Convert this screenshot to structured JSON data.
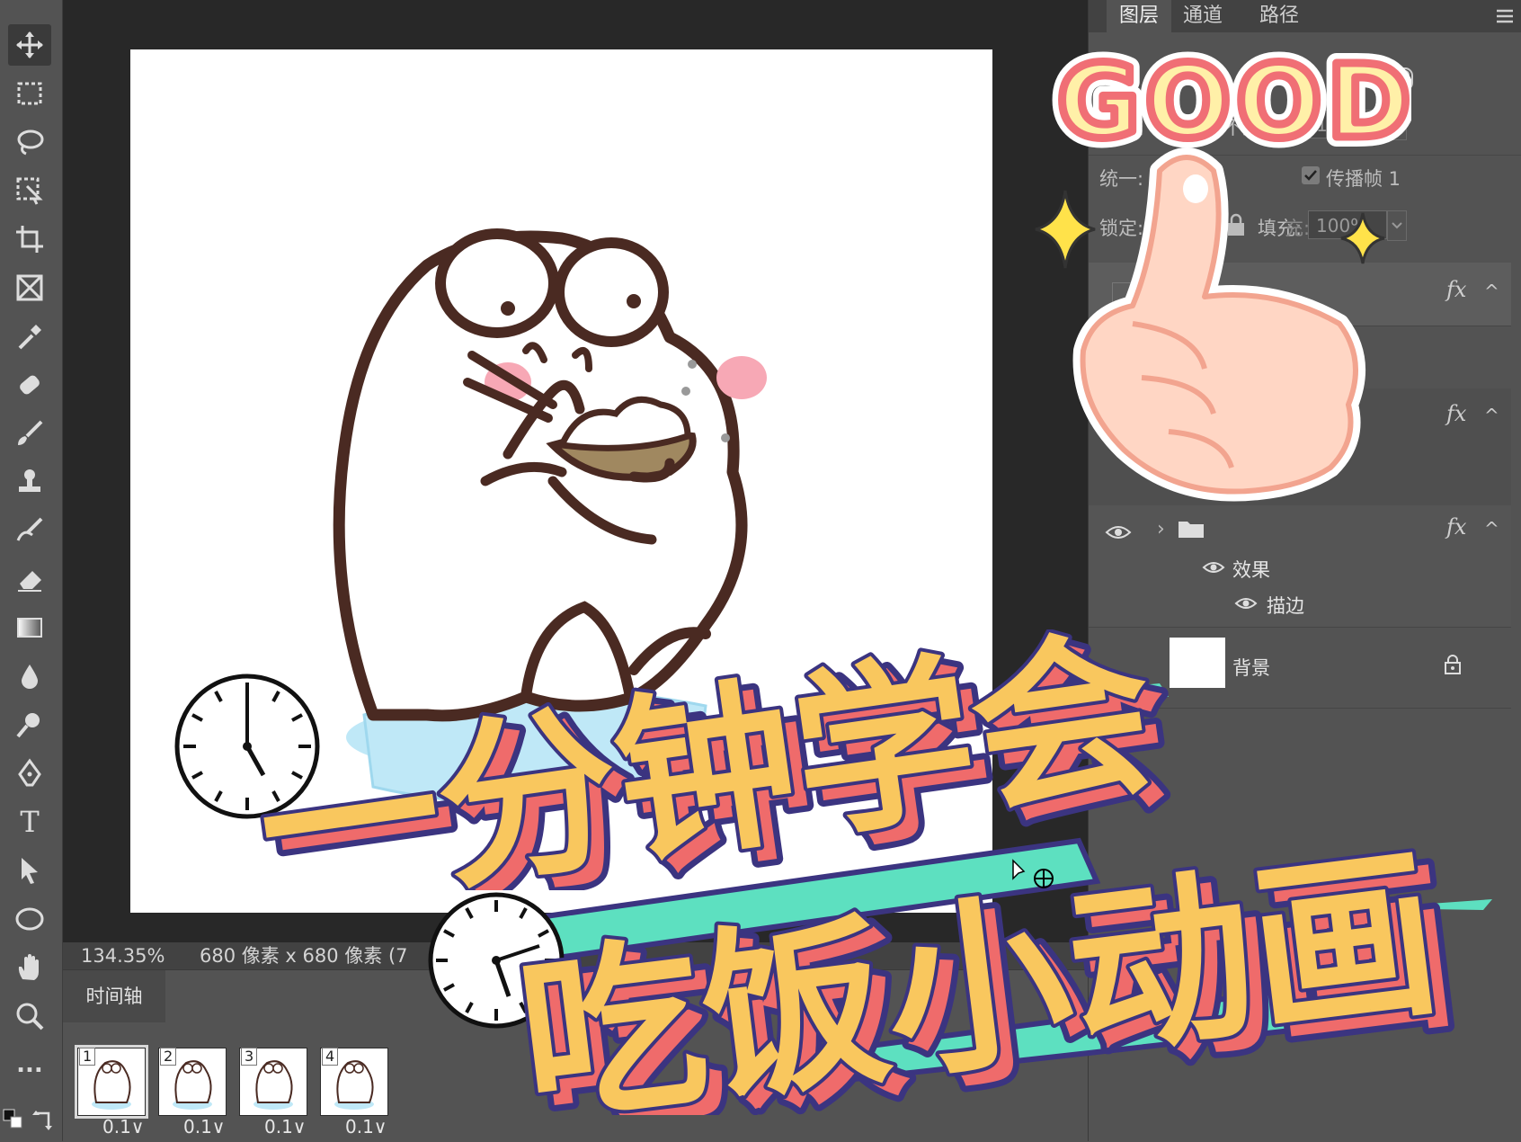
{
  "document": {
    "tabs": [
      "",
      ""
    ],
    "status_zoom": "134.35%",
    "status_size": "680 像素 x 680 像素 (7"
  },
  "toolbar": {
    "tools": [
      "move-icon",
      "marquee-icon",
      "lasso-icon",
      "object-select-icon",
      "crop-icon",
      "frame-icon",
      "eyedropper-icon",
      "healing-brush-icon",
      "brush-icon",
      "clone-stamp-icon",
      "history-brush-icon",
      "eraser-icon",
      "gradient-icon",
      "blur-icon",
      "dodge-icon",
      "pen-icon",
      "type-icon",
      "path-select-icon",
      "ellipse-icon",
      "hand-icon",
      "zoom-icon",
      "more-icon"
    ],
    "type_glyph": "T",
    "more_glyph": "..."
  },
  "timeline": {
    "tab_label": "时间轴",
    "frames": [
      {
        "num": "1",
        "delay": "0.1∨"
      },
      {
        "num": "2",
        "delay": "0.1∨"
      },
      {
        "num": "3",
        "delay": "0.1∨"
      },
      {
        "num": "4",
        "delay": "0.1∨"
      }
    ]
  },
  "layers_panel": {
    "tabs": [
      "图层",
      "通道",
      "路径"
    ],
    "opacity_label": "不透明度:",
    "opacity_value": "100%",
    "unify_label": "统一:",
    "propagate_label": "传播帧 1",
    "lock_label": "锁定:",
    "fill_label": "填充:",
    "fill_value": "100%",
    "fx_label": "fx",
    "effects_label": "效果",
    "stroke_label": "描边",
    "background_label": "背景",
    "transparency_fragment": "透",
    "opacity_fragment": "不",
    "opacity_fragment2": "明度:",
    "fill_fragment": "充:"
  },
  "overlay": {
    "good_text": "GOOD",
    "title_line1": "一分钟学会",
    "title_line2": "吃饭小动画"
  },
  "colors": {
    "ps_dark": "#535353",
    "canvas_bg": "#282828",
    "title_fill": "#f9c75e",
    "title_shadow": "#ef6b6b",
    "title_outline": "#3b3480",
    "accent_teal": "#5de0c0",
    "good_fill": "#fff0a8",
    "good_stroke": "#f06f75",
    "blush": "#f7a8b5",
    "cushion": "#bfe8f7",
    "line_brown": "#4a2a22"
  }
}
